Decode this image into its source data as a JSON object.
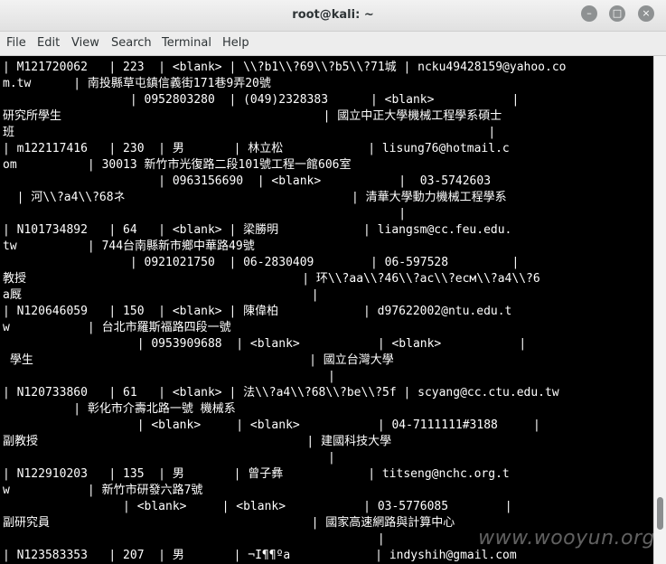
{
  "window": {
    "title": "root@kali: ~",
    "buttons": {
      "minimize": "–",
      "maximize": "□",
      "close": "×"
    }
  },
  "menubar": {
    "items": [
      "File",
      "Edit",
      "View",
      "Search",
      "Terminal",
      "Help"
    ]
  },
  "terminal": {
    "lines": [
      "| M121720062   | 223  | <blank> | \\\\?b1\\\\?69\\\\?b5\\\\?71城 | ncku49428159@yahoo.co",
      "m.tw      | 南投縣草屯鎮信義街171巷9弄20號",
      "                  | 0952803280  | (049)2328383      | <blank>           |",
      "研究所學生                                     | 國立中正大學機械工程學系碩士",
      "班                                                                   |",
      "| m122117416   | 230  | 男       | 林立松            | lisung76@hotmail.c",
      "om          | 30013 新竹市光復路二段101號工程一館606室",
      "                      | 0963156690  | <blank>           |  03-5742603",
      "  | 河\\\\?a4\\\\?68ネ                                | 清華大學動力機械工程學系",
      "                                                        |",
      "| N101734892   | 64   | <blank> | 梁勝明            | liangsm@cc.feu.edu.",
      "tw          | 744台南縣新市鄉中華路49號",
      "                  | 0921021750  | 06-2830409        | 06-597528         |",
      "教授                                       | 环\\\\?aa\\\\?46\\\\?ac\\\\?есм\\\\?a4\\\\?6",
      "a厩                                         |",
      "| N120646059   | 150  | <blank> | 陳偉柏            | d97622002@ntu.edu.t",
      "w           | 台北市羅斯福路四段一號",
      "                   | 0953909688  | <blank>           | <blank>           |",
      " 學生                                       | 國立台灣大學",
      "                                              |",
      "| N120733860   | 61   | <blank> | 法\\\\?a4\\\\?68\\\\?be\\\\?5f | scyang@cc.ctu.edu.tw",
      "          | 彰化市介壽北路一號 機械系",
      "                   | <blank>     | <blank>           | 04-7111111#3188     |",
      "副教授                                      | 建國科技大學",
      "                                              |",
      "| N122910203   | 135  | 男       | 曾子彝            | titseng@nchc.org.t",
      "w           | 新竹市研發六路7號",
      "                 | <blank>     | <blank>           | 03-5776085        |",
      "副研究員                                     | 國家高速網路與計算中心",
      "                                                     |",
      "| N123583353   | 207  | 男       | ¬I¶¶ºa            | indyshih@gmail.com"
    ]
  },
  "watermark": "www.wooyun.org"
}
